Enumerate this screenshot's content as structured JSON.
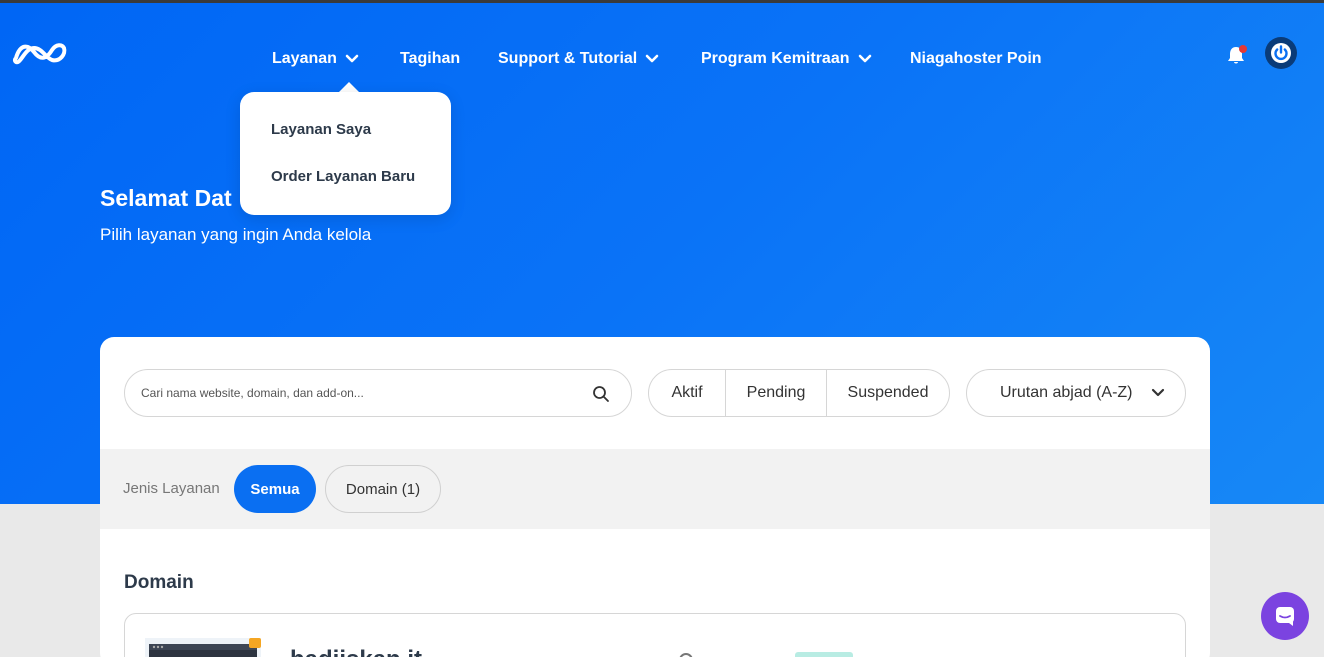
{
  "nav": {
    "items": [
      {
        "label": "Layanan",
        "has_dropdown": true
      },
      {
        "label": "Tagihan",
        "has_dropdown": false
      },
      {
        "label": "Support & Tutorial",
        "has_dropdown": true
      },
      {
        "label": "Program Kemitraan",
        "has_dropdown": true
      },
      {
        "label": "Niagahoster Poin",
        "has_dropdown": false
      }
    ],
    "icons": {
      "logo": "niagahoster-logo-icon",
      "bell": "bell-icon",
      "power": "power-icon",
      "chevron": "chevron-down-icon"
    }
  },
  "dropdown": {
    "items": [
      {
        "label": "Layanan Saya"
      },
      {
        "label": "Order Layanan Baru"
      }
    ]
  },
  "hero": {
    "title": "Selamat Dat",
    "subtitle": "Pilih layanan yang ingin Anda kelola"
  },
  "filters": {
    "search_placeholder": "Cari nama website, domain, dan add-on...",
    "status": [
      "Aktif",
      "Pending",
      "Suspended"
    ],
    "sort_label": "Urutan abjad (A-Z)"
  },
  "service_type": {
    "label": "Jenis Layanan",
    "chips": [
      {
        "label": "Semua",
        "active": true
      },
      {
        "label": "Domain (1)",
        "active": false
      }
    ]
  },
  "section": {
    "title": "Domain",
    "item_name": "hadiiskan.it..."
  },
  "colors": {
    "accent": "#0a6ff2",
    "hero_blue": "#0066f5",
    "notification_dot": "#e53935",
    "chat": "#7b43e0"
  }
}
